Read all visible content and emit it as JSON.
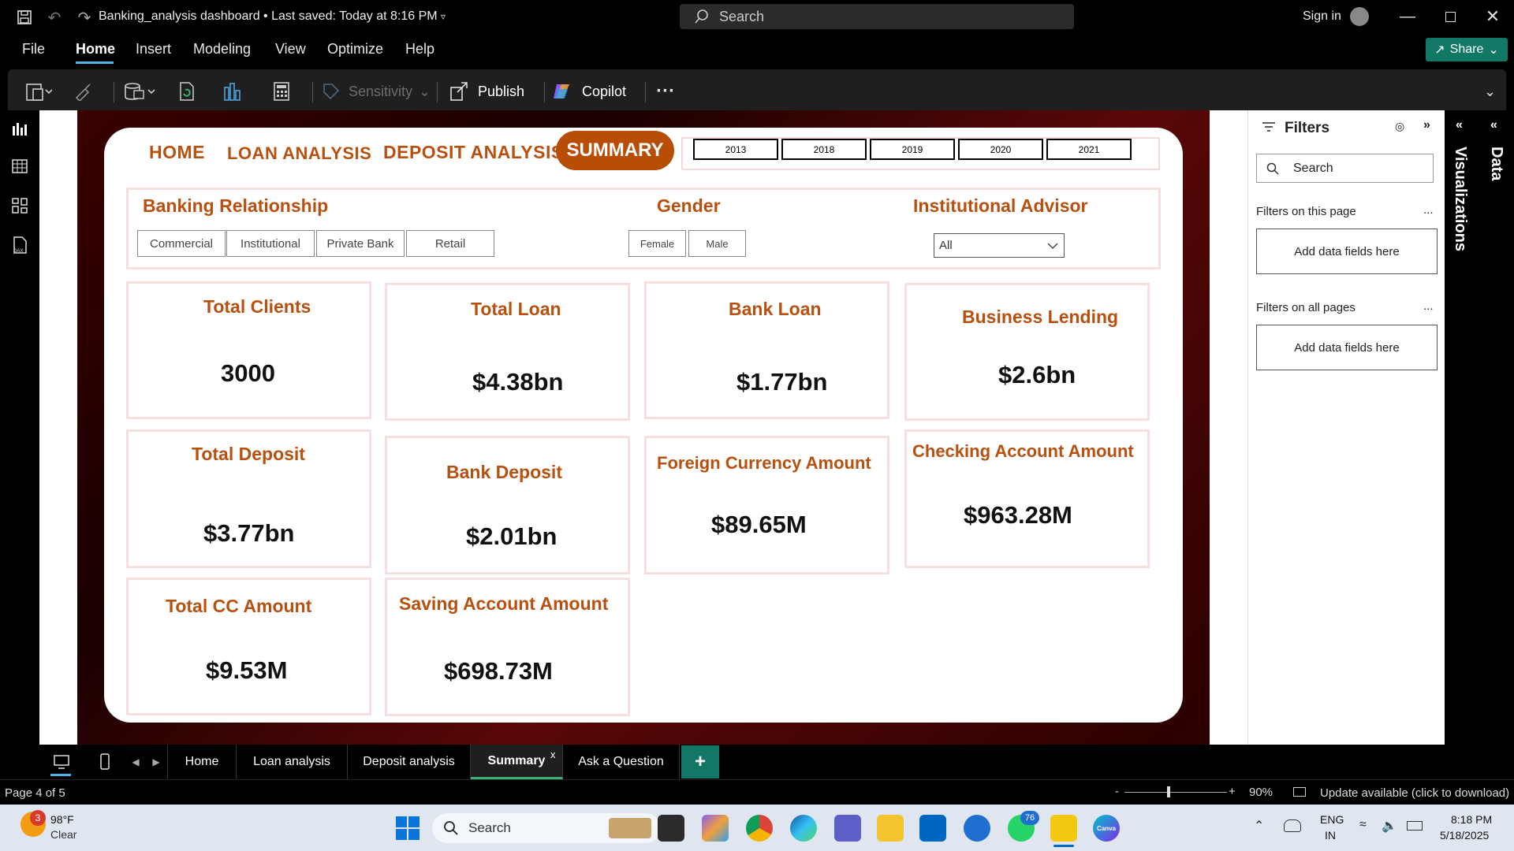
{
  "titlebar": {
    "doc_title": "Banking_analysis dashboard",
    "saved": "• Last saved: Today at 8:16 PM",
    "search_placeholder": "Search",
    "sign_in": "Sign in"
  },
  "menu": {
    "items": [
      "File",
      "Home",
      "Insert",
      "Modeling",
      "View",
      "Optimize",
      "Help"
    ],
    "active": "Home",
    "share": "Share"
  },
  "ribbon": {
    "sensitivity": "Sensitivity",
    "publish": "Publish",
    "copilot": "Copilot",
    "more": "···"
  },
  "report": {
    "nav": [
      "HOME",
      "LOAN ANALYSIS",
      "DEPOSIT ANALYSIS",
      "SUMMARY"
    ],
    "years": [
      "2013",
      "2018",
      "2019",
      "2020",
      "2021"
    ],
    "slicers": {
      "banking_relationship": {
        "title": "Banking Relationship",
        "options": [
          "Commercial",
          "Institutional",
          "Private Bank",
          "Retail"
        ]
      },
      "gender": {
        "title": "Gender",
        "options": [
          "Female",
          "Male"
        ]
      },
      "advisor": {
        "title": "Institutional Advisor",
        "selected": "All"
      }
    },
    "cards": [
      {
        "title": "Total Clients",
        "value": "3000"
      },
      {
        "title": "Total Loan",
        "value": "$4.38bn"
      },
      {
        "title": "Bank Loan",
        "value": "$1.77bn"
      },
      {
        "title": "Business Lending",
        "value": "$2.6bn"
      },
      {
        "title": "Total Deposit",
        "value": "$3.77bn"
      },
      {
        "title": "Bank Deposit",
        "value": "$2.01bn"
      },
      {
        "title": "Foreign Currency Amount",
        "value": "$89.65M"
      },
      {
        "title": "Checking Account Amount",
        "value": "$963.28M"
      },
      {
        "title": "Total CC Amount",
        "value": "$9.53M"
      },
      {
        "title": "Saving Account Amount",
        "value": "$698.73M"
      }
    ]
  },
  "filters": {
    "title": "Filters",
    "search_placeholder": "Search",
    "on_this_page": "Filters on this page",
    "on_all_pages": "Filters on all pages",
    "add_fields": "Add data fields here",
    "ellipsis": "..."
  },
  "side_panes": {
    "visualizations": "Visualizations",
    "data": "Data"
  },
  "page_tabs": {
    "tabs": [
      "Home",
      "Loan analysis",
      "Deposit analysis",
      "Summary",
      "Ask a Question"
    ],
    "active": "Summary",
    "close": "x",
    "add": "+"
  },
  "status": {
    "page": "Page 4 of 5",
    "zoom_minus": "-",
    "zoom_plus": "+",
    "zoom": "90%",
    "update": "Update available (click to download)"
  },
  "taskbar": {
    "weather_temp": "98°F",
    "weather_desc": "Clear",
    "weather_badge": "3",
    "search": "Search",
    "whatsapp_badge": "76",
    "lang": "ENG",
    "region": "IN",
    "time": "8:18 PM",
    "date": "5/18/2025",
    "canva": "Canva"
  },
  "colors": {
    "accent_orange": "#b84d06",
    "share_green": "#117865",
    "tab_underline": "#4db3e8",
    "card_border": "#f6e0df"
  }
}
